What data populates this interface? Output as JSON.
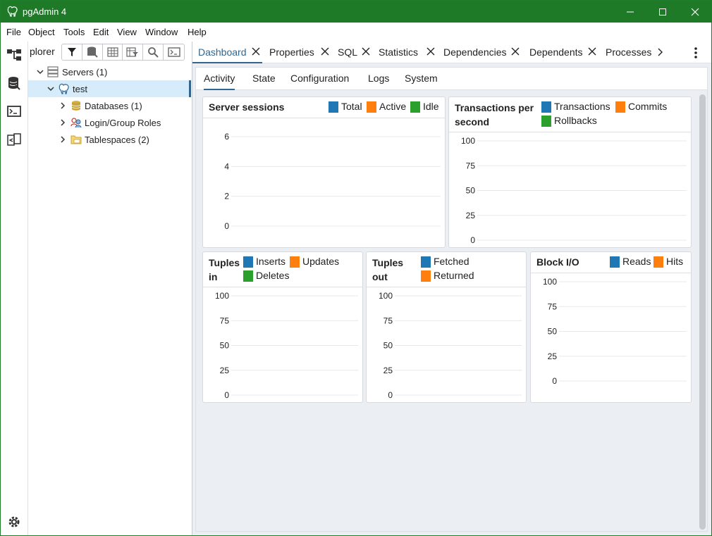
{
  "window": {
    "title": "pgAdmin 4",
    "accent": "#1f7a28"
  },
  "menu": [
    "File",
    "Object",
    "Tools",
    "Edit",
    "View",
    "Window",
    "Help"
  ],
  "iconbar": [
    "object-explorer-icon",
    "query-tool-icon",
    "psql-tool-icon",
    "schema-diff-icon",
    "settings-icon"
  ],
  "explorer": {
    "tab_title": "plorer",
    "toolbar": [
      "filter-icon",
      "database-view-icon",
      "table-view-icon",
      "filtered-rows-icon",
      "search-icon",
      "psql-icon"
    ],
    "tree": [
      {
        "label": "Servers (1)",
        "level": 0,
        "expanded": true,
        "icon": "servers-icon"
      },
      {
        "label": "test",
        "level": 1,
        "expanded": true,
        "icon": "postgres-elephant-icon",
        "selected": true
      },
      {
        "label": "Databases (1)",
        "level": 2,
        "expanded": false,
        "icon": "databases-icon"
      },
      {
        "label": "Login/Group Roles",
        "level": 2,
        "expanded": false,
        "icon": "roles-icon"
      },
      {
        "label": "Tablespaces (2)",
        "level": 2,
        "expanded": false,
        "icon": "tablespaces-icon"
      }
    ]
  },
  "main_tabs": [
    {
      "label": "Dashboard",
      "active": true,
      "closable": true
    },
    {
      "label": "Properties",
      "closable": true
    },
    {
      "label": "SQL",
      "closable": true
    },
    {
      "label": "Statistics",
      "closable": true
    },
    {
      "label": "Dependencies",
      "closable": true
    },
    {
      "label": "Dependents",
      "closable": true
    },
    {
      "label": "Processes",
      "closable": false
    }
  ],
  "sub_tabs": [
    {
      "label": "Activity",
      "active": true
    },
    {
      "label": "State"
    },
    {
      "label": "Configuration"
    },
    {
      "label": "Logs"
    },
    {
      "label": "System"
    }
  ],
  "colors": {
    "blue": "#1f77b4",
    "orange": "#ff7f0e",
    "green": "#2ca02c",
    "selection": "#d6ecfa",
    "active_tab": "#326690"
  },
  "chart_data": [
    {
      "type": "line",
      "title": "Server sessions",
      "series": [
        {
          "name": "Total",
          "values": []
        },
        {
          "name": "Active",
          "values": []
        },
        {
          "name": "Idle",
          "values": []
        }
      ],
      "yticks": [
        "6",
        "4",
        "2",
        "0"
      ],
      "ylim": [
        0,
        6
      ]
    },
    {
      "type": "line",
      "title": "Transactions per second",
      "series": [
        {
          "name": "Transactions",
          "values": []
        },
        {
          "name": "Commits",
          "values": []
        },
        {
          "name": "Rollbacks",
          "values": []
        }
      ],
      "yticks": [
        "100",
        "75",
        "50",
        "25",
        "0"
      ],
      "ylim": [
        0,
        100
      ]
    },
    {
      "type": "line",
      "title": "Tuples in",
      "series": [
        {
          "name": "Inserts",
          "values": []
        },
        {
          "name": "Updates",
          "values": []
        },
        {
          "name": "Deletes",
          "values": []
        }
      ],
      "yticks": [
        "100",
        "75",
        "50",
        "25",
        "0"
      ],
      "ylim": [
        0,
        100
      ]
    },
    {
      "type": "line",
      "title": "Tuples out",
      "series": [
        {
          "name": "Fetched",
          "values": []
        },
        {
          "name": "Returned",
          "values": []
        }
      ],
      "yticks": [
        "100",
        "75",
        "50",
        "25",
        "0"
      ],
      "ylim": [
        0,
        100
      ]
    },
    {
      "type": "line",
      "title": "Block I/O",
      "series": [
        {
          "name": "Reads",
          "values": []
        },
        {
          "name": "Hits",
          "values": []
        }
      ],
      "yticks": [
        "100",
        "75",
        "50",
        "25",
        "0"
      ],
      "ylim": [
        0,
        100
      ]
    }
  ]
}
